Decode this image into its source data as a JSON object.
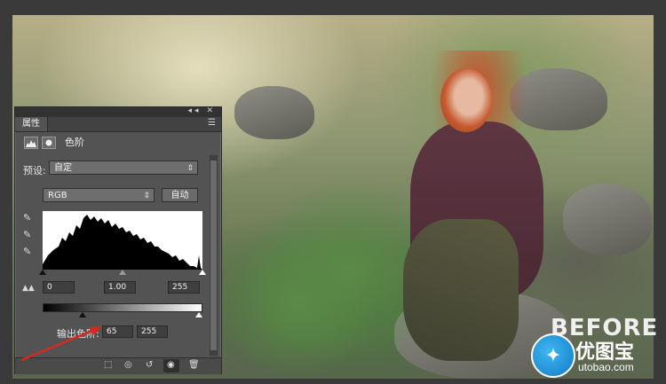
{
  "panel": {
    "tab_label": "属性",
    "title": "色阶",
    "preset_label": "预设:",
    "preset_value": "自定",
    "channel_value": "RGB",
    "auto_label": "自动",
    "input_black": "0",
    "input_gamma": "1.00",
    "input_white": "255",
    "output_label": "输出色阶:",
    "output_black": "65",
    "output_white": "255"
  },
  "watermark": {
    "before_text": "BEFORE",
    "brand": "优图宝",
    "url": "utobao.com"
  },
  "icons": {
    "panel_menu": "menu-icon",
    "collapse": "double-chevron-icon",
    "close": "close-icon",
    "adjustment_layer": "levels-icon",
    "mask": "mask-icon",
    "eyedropper_black": "eyedropper-icon",
    "eyedropper_gray": "eyedropper-icon",
    "eyedropper_white": "eyedropper-icon",
    "clip": "clip-to-layer-icon",
    "view_previous": "view-previous-icon",
    "reset": "reset-icon",
    "visibility": "eye-icon",
    "delete": "trash-icon"
  },
  "colors": {
    "panel_bg": "#535353",
    "arrow": "#d42a1e",
    "logo_blue": "#1c8ad8"
  }
}
